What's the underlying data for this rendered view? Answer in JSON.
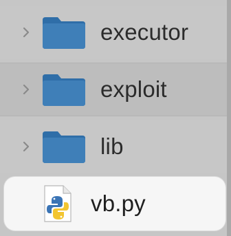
{
  "file_list": {
    "items": [
      {
        "name": "executor",
        "kind": "folder",
        "expandable": true
      },
      {
        "name": "exploit",
        "kind": "folder",
        "expandable": true
      },
      {
        "name": "lib",
        "kind": "folder",
        "expandable": true
      },
      {
        "name": "vb.py",
        "kind": "python-file",
        "expandable": false
      }
    ]
  },
  "colors": {
    "folder_blue": "#3f7fb8",
    "folder_tab": "#2f6ea8",
    "background": "#c6c6c6",
    "selected_row": "#f6f6f6"
  }
}
